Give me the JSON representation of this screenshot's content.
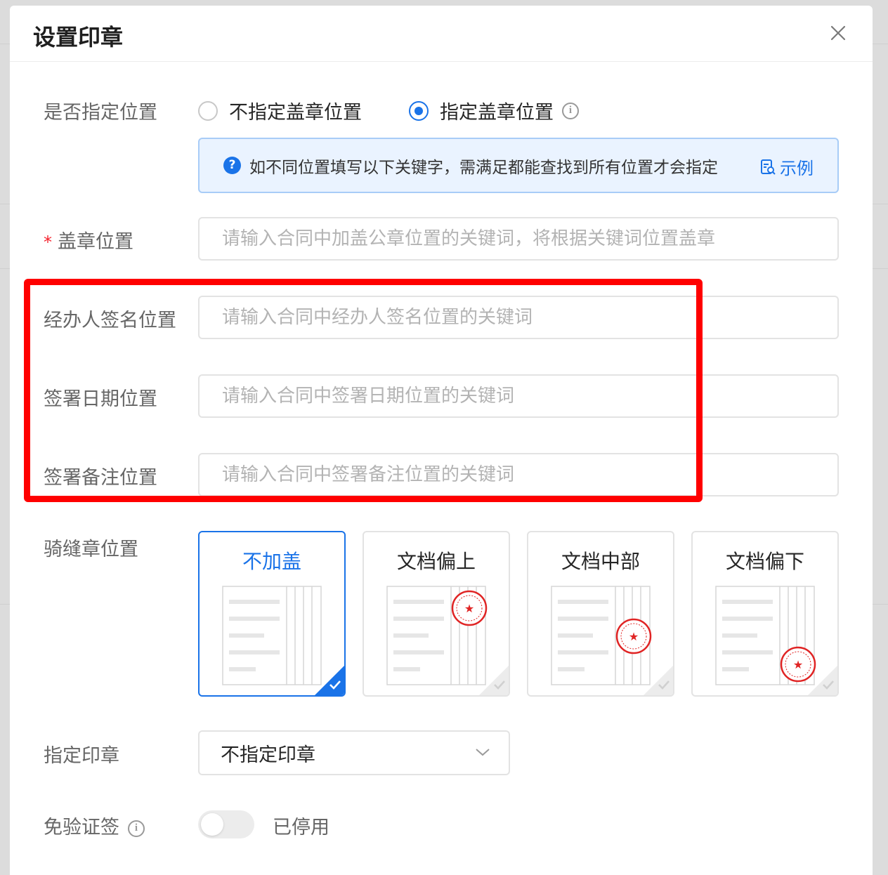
{
  "modal": {
    "title": "设置印章"
  },
  "position_mode": {
    "label": "是否指定位置",
    "options": [
      {
        "label": "不指定盖章位置",
        "checked": false
      },
      {
        "label": "指定盖章位置",
        "checked": true
      }
    ],
    "notice": "如不同位置填写以下关键字，需满足都能查找到所有位置才会指定",
    "example_link": "示例"
  },
  "fields": {
    "seal_position": {
      "label": "盖章位置",
      "required_mark": "*",
      "placeholder": "请输入合同中加盖公章位置的关键词，将根据关键词位置盖章",
      "value": ""
    },
    "handler_signature": {
      "label": "经办人签名位置",
      "placeholder": "请输入合同中经办人签名位置的关键词",
      "value": ""
    },
    "sign_date": {
      "label": "签署日期位置",
      "placeholder": "请输入合同中签署日期位置的关键词",
      "value": ""
    },
    "sign_remark": {
      "label": "签署备注位置",
      "placeholder": "请输入合同中签署备注位置的关键词",
      "value": ""
    }
  },
  "riding_seal": {
    "label": "骑缝章位置",
    "options": [
      {
        "label": "不加盖",
        "selected": true,
        "seal": "none"
      },
      {
        "label": "文档偏上",
        "selected": false,
        "seal": "top"
      },
      {
        "label": "文档中部",
        "selected": false,
        "seal": "middle"
      },
      {
        "label": "文档偏下",
        "selected": false,
        "seal": "bottom"
      }
    ]
  },
  "specify_seal": {
    "label": "指定印章",
    "value": "不指定印章"
  },
  "exempt_verify": {
    "label": "免验证签",
    "toggle_on": false,
    "status_text": "已停用"
  },
  "colors": {
    "accent": "#1a73e8",
    "highlight": "#ff0000",
    "seal_red": "#e02424"
  }
}
